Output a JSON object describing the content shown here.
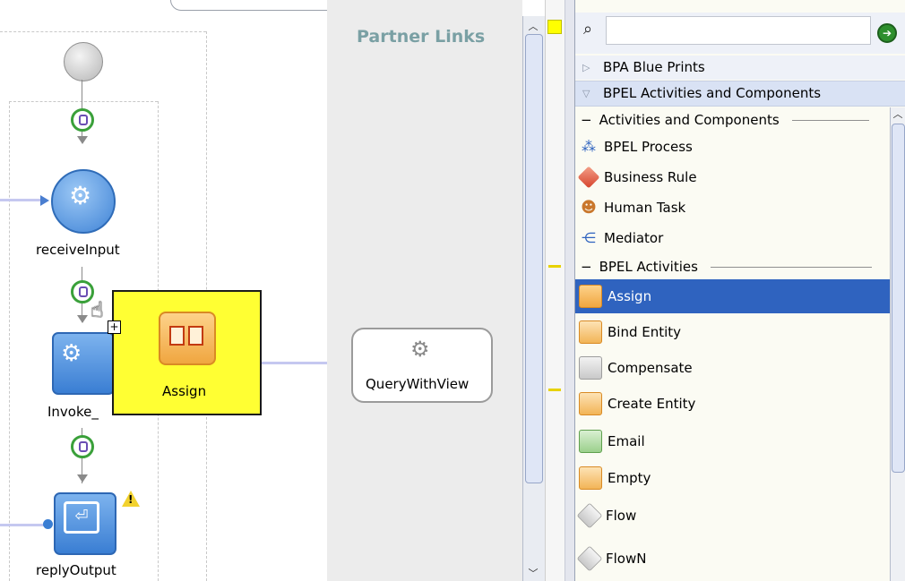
{
  "canvas": {
    "partner_lane_title": "Partner Links",
    "nodes": {
      "receive_label": "receiveInput",
      "invoke_label": "Invoke_",
      "reply_label": "replyOutput",
      "partner_label": "QueryWithView"
    },
    "drag_preview_label": "Assign"
  },
  "palette": {
    "groups": [
      {
        "label": "BPA Blue Prints",
        "expanded": false
      },
      {
        "label": "BPEL Activities and Components",
        "expanded": true
      }
    ],
    "sections": {
      "components_title": "Activities and Components",
      "activities_title": "BPEL Activities"
    },
    "components": [
      {
        "label": "BPEL Process",
        "icon": "bpel-process-icon"
      },
      {
        "label": "Business Rule",
        "icon": "business-rule-icon"
      },
      {
        "label": "Human Task",
        "icon": "human-task-icon"
      },
      {
        "label": "Mediator",
        "icon": "mediator-icon"
      }
    ],
    "activities": [
      {
        "label": "Assign",
        "icon": "assign-icon",
        "selected": true
      },
      {
        "label": "Bind Entity",
        "icon": "bind-entity-icon"
      },
      {
        "label": "Compensate",
        "icon": "compensate-icon"
      },
      {
        "label": "Create Entity",
        "icon": "create-entity-icon"
      },
      {
        "label": "Email",
        "icon": "email-icon"
      },
      {
        "label": "Empty",
        "icon": "empty-icon"
      },
      {
        "label": "Flow",
        "icon": "flow-icon"
      },
      {
        "label": "FlowN",
        "icon": "flown-icon"
      }
    ]
  },
  "colors": {
    "selection": "#2f63bf",
    "drag_preview_bg": "#ffff33",
    "partner_title": "#7aa0a4",
    "activity_blue": "#4a8fe0"
  }
}
